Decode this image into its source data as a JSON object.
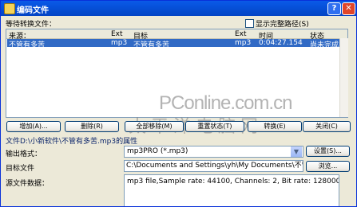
{
  "window": {
    "title": "编码文件",
    "help_label": "?",
    "close_label": "✕"
  },
  "files_label": "等待转换文件：",
  "show_full_path_label": "显示完整路径(S)",
  "columns": [
    "来源：",
    "Ext",
    "目标",
    "Ext",
    "时间",
    "状态"
  ],
  "rows": [
    [
      "不管有多苦",
      "mp3",
      "不管有多苦",
      "mp3",
      "0:04:27.154",
      "尚未完成"
    ]
  ],
  "buttons": {
    "add": "增加(A)...",
    "delete": "删除(R)",
    "delete_all": "全部移除(M)",
    "reset": "重置状态(T)",
    "convert": "转换(E)",
    "close": "关闭(C)"
  },
  "props_title": "文件D:\\小新软件\\不管有多苦.mp3的属性",
  "output_format_label": "输出格式：",
  "output_format_value": "mp3PRO (*.mp3)",
  "settings_button": "设置(S)...",
  "target_label": "目标文件",
  "target_value": "C:\\Documents and Settings\\yh\\My Documents\\不管有多苦.mp3",
  "browse_button": "浏览...",
  "source_data_label": "源文件数据：",
  "source_data_value": "mp3 file,Sample rate: 44100, Channels: 2, Bit rate: 128000",
  "watermark": {
    "line1": "PConline.com.cn",
    "line2": "太平洋电脑网"
  }
}
